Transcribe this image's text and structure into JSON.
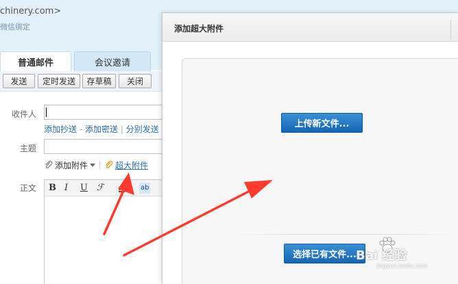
{
  "account": {
    "email_partial": "chinery.com>",
    "wechat_link": "微信绑定"
  },
  "tabs": [
    {
      "label": "普通邮件",
      "active": true
    },
    {
      "label": "会议邀请",
      "active": false
    }
  ],
  "toolbar": {
    "send": "发送",
    "timed_send": "定时发送",
    "save_draft": "存草稿",
    "close": "关闭"
  },
  "compose": {
    "to_label": "收件人",
    "to_value": "",
    "cc_links": [
      "添加抄送",
      "添加密送",
      "分别发送"
    ],
    "cc_separators": [
      "-",
      "|"
    ],
    "subject_label": "主题",
    "subject_value": "",
    "attach": "添加附件",
    "super_attach": "超大附件",
    "body_label": "正文",
    "editor_tools": {
      "bold": "B",
      "italic": "I",
      "underline": "U",
      "font": "ℱ",
      "color": "A",
      "bg": "ab"
    }
  },
  "dialog": {
    "title": "添加超大附件",
    "upload_button": "上传新文件...",
    "choose_button": "选择已有文件..."
  },
  "watermark": {
    "brand": "Bai 经验",
    "sub": "jingyan.baidu.com"
  },
  "colors": {
    "accent_blue": "#1a6fc0",
    "header_band": "#e3f1fb",
    "arrow_red": "#ff3b2f",
    "link": "#2a6db0"
  }
}
